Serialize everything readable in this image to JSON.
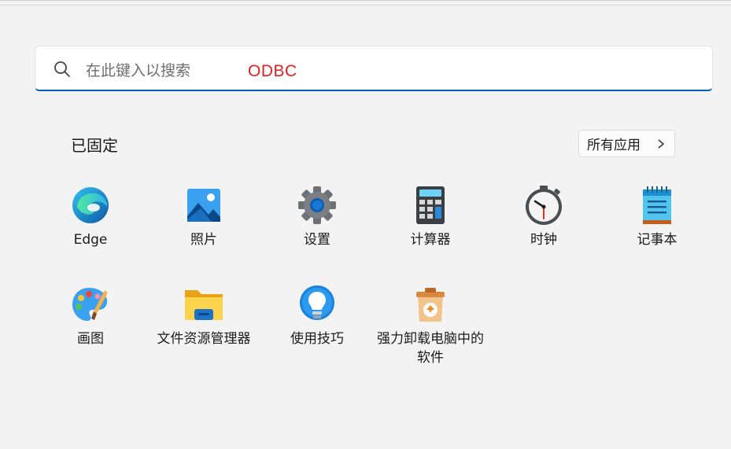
{
  "search": {
    "placeholder": "在此键入以搜索",
    "value": "ODBC"
  },
  "pinned": {
    "title": "已固定",
    "all_apps_label": "所有应用"
  },
  "apps": [
    {
      "label": "Edge",
      "icon": "edge-icon"
    },
    {
      "label": "照片",
      "icon": "photos-icon"
    },
    {
      "label": "设置",
      "icon": "settings-gear-icon"
    },
    {
      "label": "计算器",
      "icon": "calculator-icon"
    },
    {
      "label": "时钟",
      "icon": "clock-icon"
    },
    {
      "label": "记事本",
      "icon": "notepad-icon"
    },
    {
      "label": "画图",
      "icon": "paint-palette-icon"
    },
    {
      "label": "文件资源管理器",
      "icon": "folder-icon"
    },
    {
      "label": "使用技巧",
      "icon": "lightbulb-icon"
    },
    {
      "label": "强力卸载电脑中的软件",
      "icon": "uninstaller-box-icon"
    }
  ],
  "colors": {
    "accent": "#005fb8",
    "search_value": "#e02020"
  }
}
